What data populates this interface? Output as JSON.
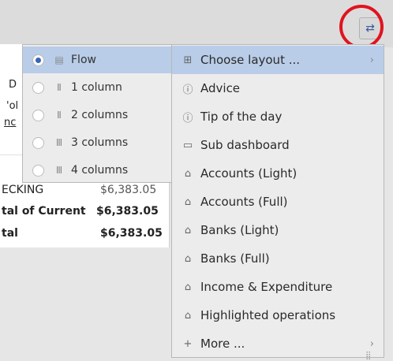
{
  "toolbar": {
    "settings_icon": "swap-arrows-icon"
  },
  "background": {
    "frag1": "D",
    "frag2": "'ol",
    "frag3": "nc",
    "rows": [
      {
        "label": "ECKING",
        "value": "$6,383.05",
        "bold": false
      },
      {
        "label": "tal of Current",
        "value": "$6,383.05",
        "bold": true
      },
      {
        "label": "tal",
        "value": "$6,383.05",
        "bold": true
      }
    ]
  },
  "submenu": {
    "items": [
      {
        "label": "Flow",
        "selected": true
      },
      {
        "label": "1 column",
        "selected": false
      },
      {
        "label": "2 columns",
        "selected": false
      },
      {
        "label": "3 columns",
        "selected": false
      },
      {
        "label": "4 columns",
        "selected": false
      }
    ]
  },
  "menu": {
    "items": [
      {
        "label": "Choose layout ...",
        "icon": "layout-icon",
        "submenu": true
      },
      {
        "label": "Advice",
        "icon": "advice-icon"
      },
      {
        "label": "Tip of the day",
        "icon": "tip-icon"
      },
      {
        "label": "Sub dashboard",
        "icon": "dashboard-icon"
      },
      {
        "label": "Accounts (Light)",
        "icon": "bank-icon"
      },
      {
        "label": "Accounts (Full)",
        "icon": "bank-icon"
      },
      {
        "label": "Banks (Light)",
        "icon": "bank-icon"
      },
      {
        "label": "Banks (Full)",
        "icon": "bank-icon"
      },
      {
        "label": "Income & Expenditure",
        "icon": "bank-icon"
      },
      {
        "label": "Highlighted operations",
        "icon": "bank-icon"
      },
      {
        "label": "More ...",
        "icon": "plus-icon",
        "submenu": true
      }
    ]
  },
  "colors": {
    "highlight": "#b9cde8",
    "ring": "#e0141e",
    "radio_dot": "#3a66b3"
  }
}
